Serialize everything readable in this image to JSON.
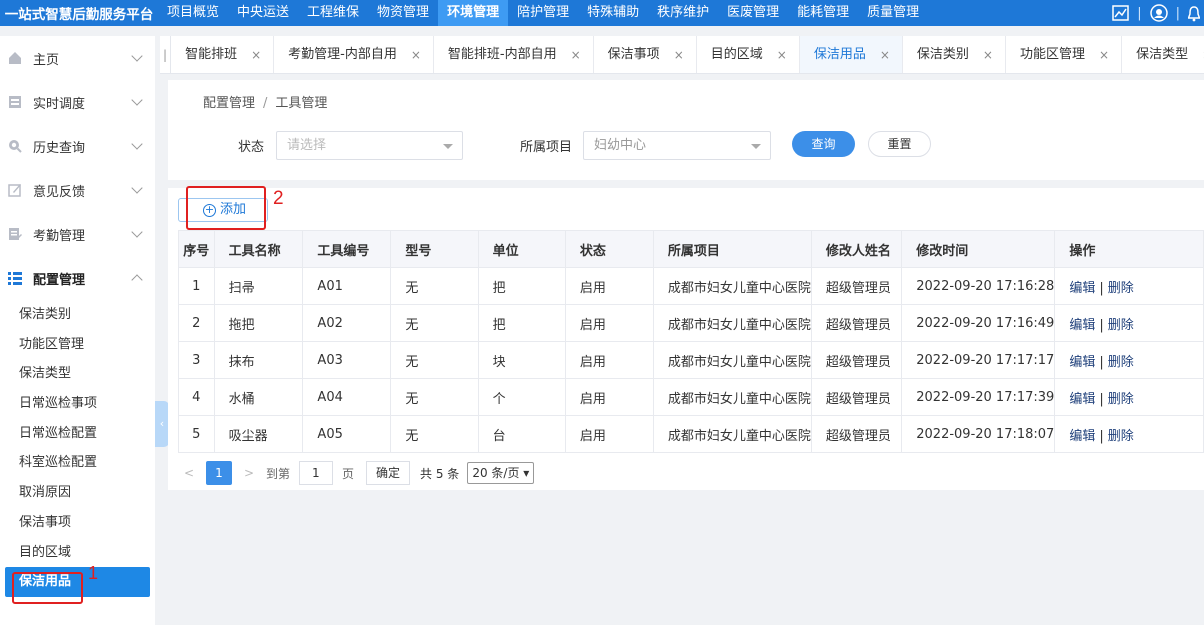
{
  "app_title": "一站式智慧后勤服务平台",
  "top_nav": [
    {
      "label": "项目概览",
      "active": false
    },
    {
      "label": "中央运送",
      "active": false
    },
    {
      "label": "工程维保",
      "active": false
    },
    {
      "label": "物资管理",
      "active": false
    },
    {
      "label": "环境管理",
      "active": true
    },
    {
      "label": "陪护管理",
      "active": false
    },
    {
      "label": "特殊辅助",
      "active": false
    },
    {
      "label": "秩序维护",
      "active": false
    },
    {
      "label": "医废管理",
      "active": false
    },
    {
      "label": "能耗管理",
      "active": false
    },
    {
      "label": "质量管理",
      "active": false
    }
  ],
  "top_icons": [
    "chart-icon",
    "user-icon",
    "bell-icon"
  ],
  "top_icon_separator": "|",
  "sidebar": {
    "menus": [
      {
        "label": "主页",
        "icon": "home-icon"
      },
      {
        "label": "实时调度",
        "icon": "dispatch-icon"
      },
      {
        "label": "历史查询",
        "icon": "history-icon"
      },
      {
        "label": "意见反馈",
        "icon": "feedback-icon"
      },
      {
        "label": "考勤管理",
        "icon": "attendance-icon"
      }
    ],
    "open_menu": {
      "label": "配置管理",
      "icon": "config-icon"
    },
    "sub_items": [
      {
        "label": "保洁类别",
        "active": false
      },
      {
        "label": "功能区管理",
        "active": false
      },
      {
        "label": "保洁类型",
        "active": false
      },
      {
        "label": "日常巡检事项",
        "active": false
      },
      {
        "label": "日常巡检配置",
        "active": false
      },
      {
        "label": "科室巡检配置",
        "active": false
      },
      {
        "label": "取消原因",
        "active": false
      },
      {
        "label": "保洁事项",
        "active": false
      },
      {
        "label": "目的区域",
        "active": false
      },
      {
        "label": "保洁用品",
        "active": true
      }
    ]
  },
  "tabs": [
    {
      "label": "智能排班",
      "active": false
    },
    {
      "label": "考勤管理-内部自用",
      "active": false
    },
    {
      "label": "智能排班-内部自用",
      "active": false
    },
    {
      "label": "保洁事项",
      "active": false
    },
    {
      "label": "目的区域",
      "active": false
    },
    {
      "label": "保洁用品",
      "active": true
    },
    {
      "label": "保洁类别",
      "active": false
    },
    {
      "label": "功能区管理",
      "active": false
    },
    {
      "label": "保洁类型",
      "active": false
    }
  ],
  "tab_close": "×",
  "tab_prev": "|<",
  "breadcrumb": {
    "parent": "配置管理",
    "separator": "/",
    "current": "工具管理"
  },
  "filter": {
    "status_label": "状态",
    "status_placeholder": "请选择",
    "project_label": "所属项目",
    "project_value": "妇幼中心",
    "query_button": "查询",
    "reset_button": "重置"
  },
  "add_button": "添加",
  "table": {
    "columns": [
      "序号",
      "工具名称",
      "工具编号",
      "型号",
      "单位",
      "状态",
      "所属项目",
      "修改人姓名",
      "修改时间",
      "操作"
    ],
    "rows": [
      {
        "no": "1",
        "name": "扫帚",
        "code": "A01",
        "model": "无",
        "unit": "把",
        "status": "启用",
        "project": "成都市妇女儿童中心医院",
        "modifier": "超级管理员",
        "time": "2022-09-20 17:16:28"
      },
      {
        "no": "2",
        "name": "拖把",
        "code": "A02",
        "model": "无",
        "unit": "把",
        "status": "启用",
        "project": "成都市妇女儿童中心医院",
        "modifier": "超级管理员",
        "time": "2022-09-20 17:16:49"
      },
      {
        "no": "3",
        "name": "抹布",
        "code": "A03",
        "model": "无",
        "unit": "块",
        "status": "启用",
        "project": "成都市妇女儿童中心医院",
        "modifier": "超级管理员",
        "time": "2022-09-20 17:17:17"
      },
      {
        "no": "4",
        "name": "水桶",
        "code": "A04",
        "model": "无",
        "unit": "个",
        "status": "启用",
        "project": "成都市妇女儿童中心医院",
        "modifier": "超级管理员",
        "time": "2022-09-20 17:17:39"
      },
      {
        "no": "5",
        "name": "吸尘器",
        "code": "A05",
        "model": "无",
        "unit": "台",
        "status": "启用",
        "project": "成都市妇女儿童中心医院",
        "modifier": "超级管理员",
        "time": "2022-09-20 17:18:07"
      }
    ],
    "edit_label": "编辑",
    "op_separator": "|",
    "delete_label": "删除"
  },
  "pagination": {
    "prev": "<",
    "current_page": "1",
    "next": ">",
    "goto_label": "到第",
    "goto_value": "1",
    "page_unit": "页",
    "confirm": "确定",
    "total": "共 5 条",
    "page_size": "20 条/页"
  },
  "annotations": {
    "marker_1": "1",
    "marker_2": "2"
  },
  "colors": {
    "primary": "#1e78d7",
    "highlight": "#e02020"
  }
}
